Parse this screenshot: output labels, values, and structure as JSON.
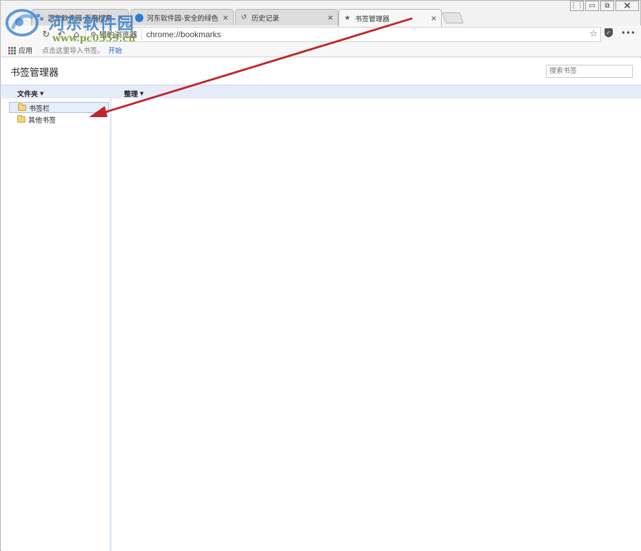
{
  "window": {
    "controls": {
      "minimize": "▭",
      "restore": "⧉",
      "close": "✕"
    }
  },
  "tabs": [
    {
      "title": "河东软件园-百度搜索",
      "icon": "paw-icon",
      "active": false
    },
    {
      "title": "河东软件园-安全的绿色",
      "icon": "globe-icon",
      "active": false
    },
    {
      "title": "历史记录",
      "icon": "history-icon",
      "active": false
    },
    {
      "title": "书签管理器",
      "icon": "star-icon",
      "active": true
    }
  ],
  "tab_close_glyph": "×",
  "toolbar": {
    "engine_badge": "猎豹浏览器",
    "url": "chrome://bookmarks",
    "bookmark_star": "☆",
    "menu_glyph": "•••"
  },
  "bookmarks_bar": {
    "apps_label": "应用",
    "hint": "点击这里导入书签。",
    "start_link": "开始"
  },
  "page": {
    "title": "书签管理器",
    "search_placeholder": "搜索书签",
    "folders_header": "文件夹",
    "organize_header": "整理",
    "folders": [
      {
        "label": "书签栏",
        "selected": true
      },
      {
        "label": "其他书签",
        "selected": false
      }
    ]
  },
  "watermark": {
    "brand": "河东软件园",
    "url": "www.pc0359.cn"
  },
  "colors": {
    "annotation_arrow": "#c0272d",
    "column_bar": "#e5ecf8",
    "link": "#2a62c4"
  }
}
